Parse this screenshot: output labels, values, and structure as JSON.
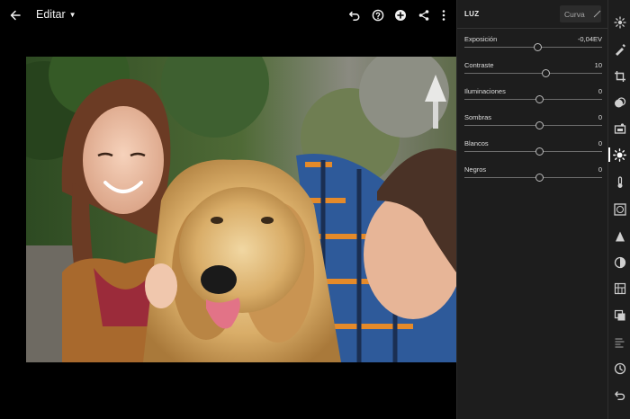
{
  "header": {
    "title": "Editar",
    "icons": [
      "back-arrow-icon",
      "caret-down-icon",
      "undo-icon",
      "help-icon",
      "add-icon",
      "share-icon",
      "more-vert-icon"
    ]
  },
  "panel": {
    "title": "LUZ",
    "curve_label": "Curva",
    "sliders": [
      {
        "label": "Exposición",
        "value": "-0,04EV",
        "level": -0.04
      },
      {
        "label": "Contraste",
        "value": "10",
        "level": 10
      },
      {
        "label": "Iluminaciones",
        "value": "0",
        "level": 0
      },
      {
        "label": "Sombras",
        "value": "0",
        "level": 0
      },
      {
        "label": "Blancos",
        "value": "0",
        "level": 0
      },
      {
        "label": "Negros",
        "value": "0",
        "level": 0
      }
    ]
  },
  "rail": {
    "icons": [
      "presets-icon",
      "healing-brush-icon",
      "crop-icon",
      "auto-icon",
      "selective-icon",
      "light-icon",
      "color-temperature-icon",
      "effects-vignette-icon",
      "detail-icon",
      "optics-icon",
      "geometry-icon",
      "versions-icon",
      "copy-settings-icon",
      "history-icon",
      "reset-icon"
    ],
    "active": "light-icon"
  },
  "colors": {
    "panel_bg": "#1d1d1d",
    "accent": "#ffffff",
    "track": "#6c6c6c"
  }
}
